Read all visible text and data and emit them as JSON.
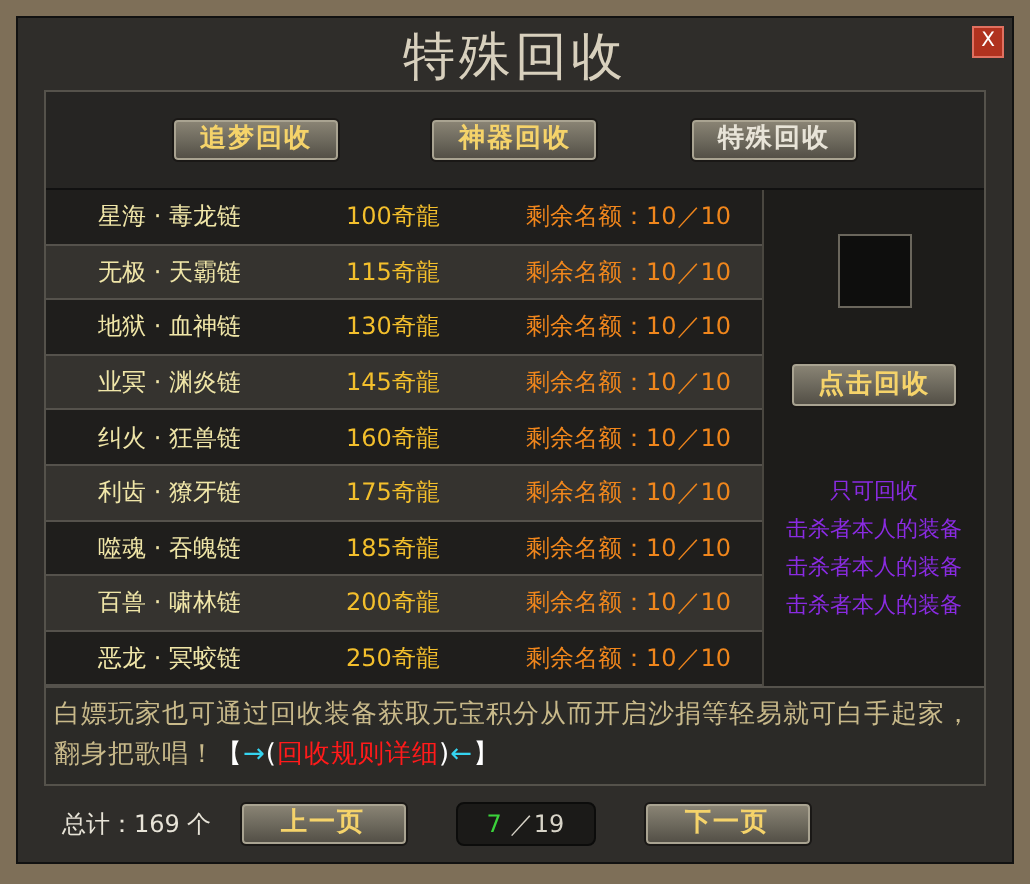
{
  "window": {
    "title": "特殊回收",
    "close": "X"
  },
  "tabs": [
    {
      "label": "追梦回收",
      "selected": false
    },
    {
      "label": "神器回收",
      "selected": false
    },
    {
      "label": "特殊回收",
      "selected": true
    }
  ],
  "items": [
    {
      "name": "星海 · 毒龙链",
      "price": "100奇龍",
      "quota": "剩余名额：10／10"
    },
    {
      "name": "无极 · 天霸链",
      "price": "115奇龍",
      "quota": "剩余名额：10／10"
    },
    {
      "name": "地狱 · 血神链",
      "price": "130奇龍",
      "quota": "剩余名额：10／10"
    },
    {
      "name": "业冥 · 渊炎链",
      "price": "145奇龍",
      "quota": "剩余名额：10／10"
    },
    {
      "name": "纠火 · 狂兽链",
      "price": "160奇龍",
      "quota": "剩余名额：10／10"
    },
    {
      "name": "利齿 · 獠牙链",
      "price": "175奇龍",
      "quota": "剩余名额：10／10"
    },
    {
      "name": "噬魂 · 吞魄链",
      "price": "185奇龍",
      "quota": "剩余名额：10／10"
    },
    {
      "name": "百兽 · 啸林链",
      "price": "200奇龍",
      "quota": "剩余名额：10／10"
    },
    {
      "name": "恶龙 · 冥蛟链",
      "price": "250奇龍",
      "quota": "剩余名额：10／10"
    }
  ],
  "side": {
    "button": "点击回收",
    "notes": [
      "只可回收",
      "击杀者本人的装备",
      "击杀者本人的装备",
      "击杀者本人的装备"
    ]
  },
  "note": {
    "text": "白嫖玩家也可通过回收装备获取元宝积分从而开启沙捐等轻易就可白手起家，翻身把歌唱！",
    "open": "【",
    "arrow_in": "→",
    "paren_open": "(",
    "link": "回收规则详细",
    "paren_close": ")",
    "arrow_out": "←",
    "close": "】"
  },
  "footer": {
    "total": "总计：169 个",
    "prev": "上一页",
    "current": "7",
    "pages": "／19",
    "next": "下一页"
  }
}
